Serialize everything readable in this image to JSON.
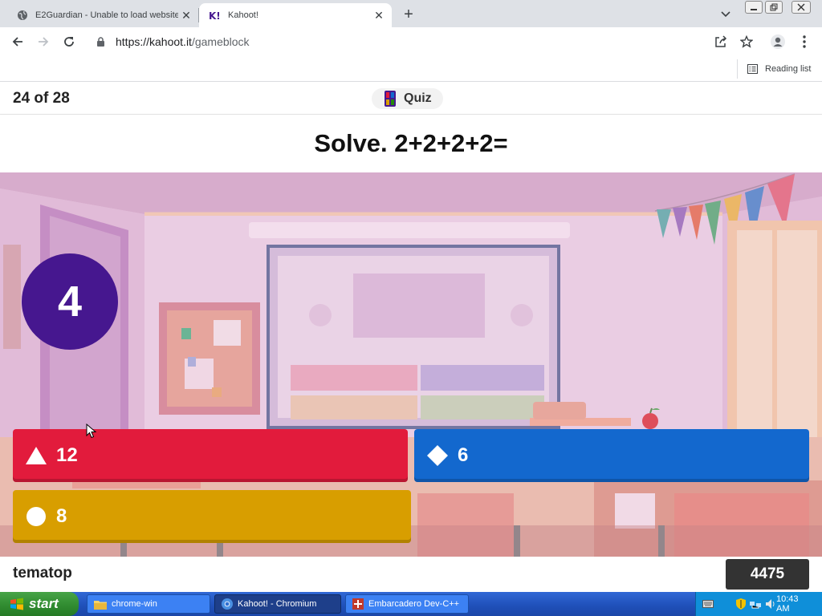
{
  "browser": {
    "tabs": [
      {
        "title": "E2Guardian - Unable to load website",
        "icon": "globe-icon",
        "active": false
      },
      {
        "title": "Kahoot!",
        "icon": "kahoot-icon",
        "active": true
      }
    ],
    "url_host": "https://kahoot.it",
    "url_path": "/gameblock",
    "reading_list_label": "Reading list"
  },
  "game": {
    "question_counter": "24 of 28",
    "mode_label": "Quiz",
    "question": "Solve. 2+2+2+2=",
    "timer": "4",
    "answers": [
      {
        "label": "12",
        "shape": "triangle",
        "color": "#e21b3c"
      },
      {
        "label": "6",
        "shape": "diamond",
        "color": "#1368ce"
      },
      {
        "label": "8",
        "shape": "circle",
        "color": "#d89e00"
      }
    ],
    "nickname": "tematop",
    "score": "4475"
  },
  "taskbar": {
    "start_label": "start",
    "items": [
      {
        "label": "chrome-win",
        "icon": "folder-icon",
        "active": false
      },
      {
        "label": "Kahoot! - Chromium",
        "icon": "chromium-icon",
        "active": true
      },
      {
        "label": "Embarcadero Dev-C++",
        "icon": "devcpp-icon",
        "active": false
      }
    ],
    "clock": "10:43 AM"
  }
}
